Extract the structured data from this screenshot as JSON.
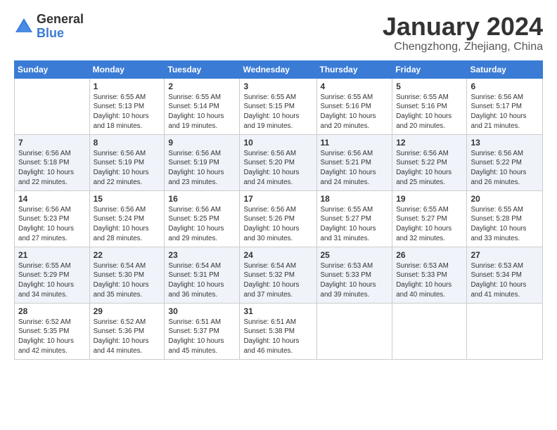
{
  "logo": {
    "general": "General",
    "blue": "Blue"
  },
  "title": "January 2024",
  "location": "Chengzhong, Zhejiang, China",
  "days_header": [
    "Sunday",
    "Monday",
    "Tuesday",
    "Wednesday",
    "Thursday",
    "Friday",
    "Saturday"
  ],
  "weeks": [
    [
      {
        "day": "",
        "info": ""
      },
      {
        "day": "1",
        "info": "Sunrise: 6:55 AM\nSunset: 5:13 PM\nDaylight: 10 hours\nand 18 minutes."
      },
      {
        "day": "2",
        "info": "Sunrise: 6:55 AM\nSunset: 5:14 PM\nDaylight: 10 hours\nand 19 minutes."
      },
      {
        "day": "3",
        "info": "Sunrise: 6:55 AM\nSunset: 5:15 PM\nDaylight: 10 hours\nand 19 minutes."
      },
      {
        "day": "4",
        "info": "Sunrise: 6:55 AM\nSunset: 5:16 PM\nDaylight: 10 hours\nand 20 minutes."
      },
      {
        "day": "5",
        "info": "Sunrise: 6:55 AM\nSunset: 5:16 PM\nDaylight: 10 hours\nand 20 minutes."
      },
      {
        "day": "6",
        "info": "Sunrise: 6:56 AM\nSunset: 5:17 PM\nDaylight: 10 hours\nand 21 minutes."
      }
    ],
    [
      {
        "day": "7",
        "info": "Sunrise: 6:56 AM\nSunset: 5:18 PM\nDaylight: 10 hours\nand 22 minutes."
      },
      {
        "day": "8",
        "info": "Sunrise: 6:56 AM\nSunset: 5:19 PM\nDaylight: 10 hours\nand 22 minutes."
      },
      {
        "day": "9",
        "info": "Sunrise: 6:56 AM\nSunset: 5:19 PM\nDaylight: 10 hours\nand 23 minutes."
      },
      {
        "day": "10",
        "info": "Sunrise: 6:56 AM\nSunset: 5:20 PM\nDaylight: 10 hours\nand 24 minutes."
      },
      {
        "day": "11",
        "info": "Sunrise: 6:56 AM\nSunset: 5:21 PM\nDaylight: 10 hours\nand 24 minutes."
      },
      {
        "day": "12",
        "info": "Sunrise: 6:56 AM\nSunset: 5:22 PM\nDaylight: 10 hours\nand 25 minutes."
      },
      {
        "day": "13",
        "info": "Sunrise: 6:56 AM\nSunset: 5:22 PM\nDaylight: 10 hours\nand 26 minutes."
      }
    ],
    [
      {
        "day": "14",
        "info": "Sunrise: 6:56 AM\nSunset: 5:23 PM\nDaylight: 10 hours\nand 27 minutes."
      },
      {
        "day": "15",
        "info": "Sunrise: 6:56 AM\nSunset: 5:24 PM\nDaylight: 10 hours\nand 28 minutes."
      },
      {
        "day": "16",
        "info": "Sunrise: 6:56 AM\nSunset: 5:25 PM\nDaylight: 10 hours\nand 29 minutes."
      },
      {
        "day": "17",
        "info": "Sunrise: 6:56 AM\nSunset: 5:26 PM\nDaylight: 10 hours\nand 30 minutes."
      },
      {
        "day": "18",
        "info": "Sunrise: 6:55 AM\nSunset: 5:27 PM\nDaylight: 10 hours\nand 31 minutes."
      },
      {
        "day": "19",
        "info": "Sunrise: 6:55 AM\nSunset: 5:27 PM\nDaylight: 10 hours\nand 32 minutes."
      },
      {
        "day": "20",
        "info": "Sunrise: 6:55 AM\nSunset: 5:28 PM\nDaylight: 10 hours\nand 33 minutes."
      }
    ],
    [
      {
        "day": "21",
        "info": "Sunrise: 6:55 AM\nSunset: 5:29 PM\nDaylight: 10 hours\nand 34 minutes."
      },
      {
        "day": "22",
        "info": "Sunrise: 6:54 AM\nSunset: 5:30 PM\nDaylight: 10 hours\nand 35 minutes."
      },
      {
        "day": "23",
        "info": "Sunrise: 6:54 AM\nSunset: 5:31 PM\nDaylight: 10 hours\nand 36 minutes."
      },
      {
        "day": "24",
        "info": "Sunrise: 6:54 AM\nSunset: 5:32 PM\nDaylight: 10 hours\nand 37 minutes."
      },
      {
        "day": "25",
        "info": "Sunrise: 6:53 AM\nSunset: 5:33 PM\nDaylight: 10 hours\nand 39 minutes."
      },
      {
        "day": "26",
        "info": "Sunrise: 6:53 AM\nSunset: 5:33 PM\nDaylight: 10 hours\nand 40 minutes."
      },
      {
        "day": "27",
        "info": "Sunrise: 6:53 AM\nSunset: 5:34 PM\nDaylight: 10 hours\nand 41 minutes."
      }
    ],
    [
      {
        "day": "28",
        "info": "Sunrise: 6:52 AM\nSunset: 5:35 PM\nDaylight: 10 hours\nand 42 minutes."
      },
      {
        "day": "29",
        "info": "Sunrise: 6:52 AM\nSunset: 5:36 PM\nDaylight: 10 hours\nand 44 minutes."
      },
      {
        "day": "30",
        "info": "Sunrise: 6:51 AM\nSunset: 5:37 PM\nDaylight: 10 hours\nand 45 minutes."
      },
      {
        "day": "31",
        "info": "Sunrise: 6:51 AM\nSunset: 5:38 PM\nDaylight: 10 hours\nand 46 minutes."
      },
      {
        "day": "",
        "info": ""
      },
      {
        "day": "",
        "info": ""
      },
      {
        "day": "",
        "info": ""
      }
    ]
  ]
}
